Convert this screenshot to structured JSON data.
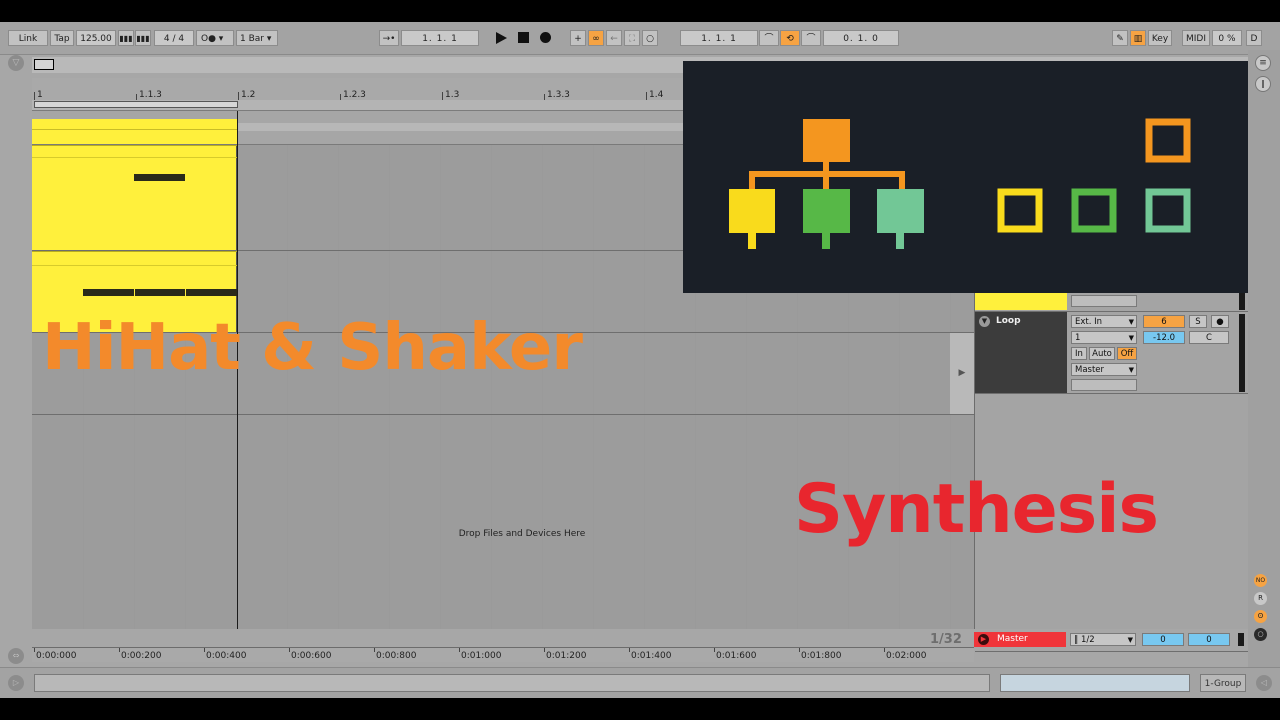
{
  "control_bar": {
    "link": "Link",
    "tap": "Tap",
    "tempo": "125.00",
    "signature": "4 / 4",
    "metronome": "O●",
    "quantize": "1 Bar",
    "arrangement_position": "1.   1.   1",
    "loop_start": "1.   1.   1",
    "loop_length": "0.   1.   0",
    "key": "Key",
    "midi": "MIDI",
    "cpu": "0 %",
    "disk": "D"
  },
  "ruler": {
    "bars": [
      "1",
      "1.1.3",
      "1.2",
      "1.2.3",
      "1.3",
      "1.3.3",
      "1.4"
    ],
    "time": [
      "0:00:000",
      "0:00:200",
      "0:00:400",
      "0:00:600",
      "0:00:800",
      "0:01:000",
      "0:01:200",
      "0:01:400",
      "0:01:600",
      "0:01:800",
      "0:02:000"
    ]
  },
  "overlay": {
    "title": "HiHat & Shaker",
    "subtitle": "Synthesis"
  },
  "drop_area": "Drop Files and Devices Here",
  "zoom": "1/32",
  "tracks": {
    "loop": {
      "name": "Loop",
      "input_type": "Ext. In",
      "input_channel": "1",
      "monitor": [
        "In",
        "Auto",
        "Off"
      ],
      "output": "Master",
      "track_number": "6",
      "solo": "S",
      "volume": "-12.0",
      "pan": "C"
    },
    "master": {
      "name": "Master",
      "cue": "1/2",
      "volume": "0",
      "pan": "0"
    }
  },
  "right_icons": [
    "NO",
    "R",
    "ʘ"
  ],
  "status": {
    "group": "1-Group"
  },
  "colors": {
    "clip_yellow": "#fff03c",
    "accent_orange": "#f6a343",
    "title_orange": "#f38a2b",
    "synthesis_red": "#e8262e",
    "master_red": "#f0353a",
    "diagram_bg": "#1a1f27",
    "node_orange": "#f4961f",
    "node_yellow": "#f9db1c",
    "node_green": "#57b847",
    "node_mint": "#72c796"
  }
}
